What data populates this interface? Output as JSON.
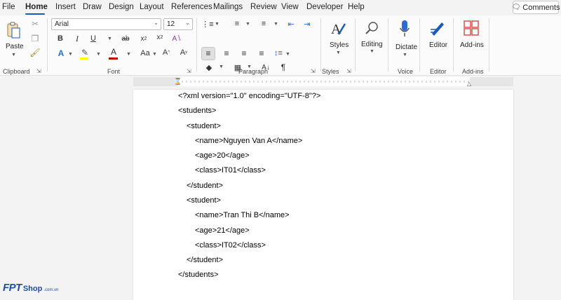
{
  "menu": {
    "tabs": [
      "File",
      "Home",
      "Insert",
      "Draw",
      "Design",
      "Layout",
      "References",
      "Mailings",
      "Review",
      "View",
      "Developer",
      "Help"
    ],
    "active_tab": "Home",
    "comments_label": "Comments"
  },
  "ribbon": {
    "clipboard": {
      "paste_label": "Paste",
      "group_label": "Clipboard"
    },
    "font": {
      "font_name": "Arial",
      "font_size": "12",
      "group_label": "Font"
    },
    "paragraph": {
      "group_label": "Paragraph"
    },
    "styles": {
      "styles_label": "Styles",
      "group_label": "Styles"
    },
    "editing": {
      "editing_label": "Editing"
    },
    "voice": {
      "dictate_label": "Dictate",
      "group_label": "Voice"
    },
    "editor": {
      "editor_label": "Editor",
      "group_label": "Editor"
    },
    "addins": {
      "addins_label": "Add-ins",
      "group_label": "Add-ins"
    }
  },
  "document": {
    "lines": [
      "<?xml version=\"1.0\" encoding=\"UTF-8\"?>",
      "<students>",
      "<student>",
      "<name>Nguyen Van A</name>",
      "<age>20</age>",
      "<class>IT01</class>",
      "</student>",
      "<student>",
      "<name>Tran Thi B</name>",
      "<age>21</age>",
      "<class>IT02</class>",
      "</student>",
      "</students>"
    ]
  },
  "watermark": {
    "brand": "FPT",
    "shop": "Shop",
    "domain": ".com.vn"
  },
  "colors": {
    "accent": "#185abd",
    "font_color_bar": "#c00000",
    "highlight_bar": "#ffff00"
  }
}
